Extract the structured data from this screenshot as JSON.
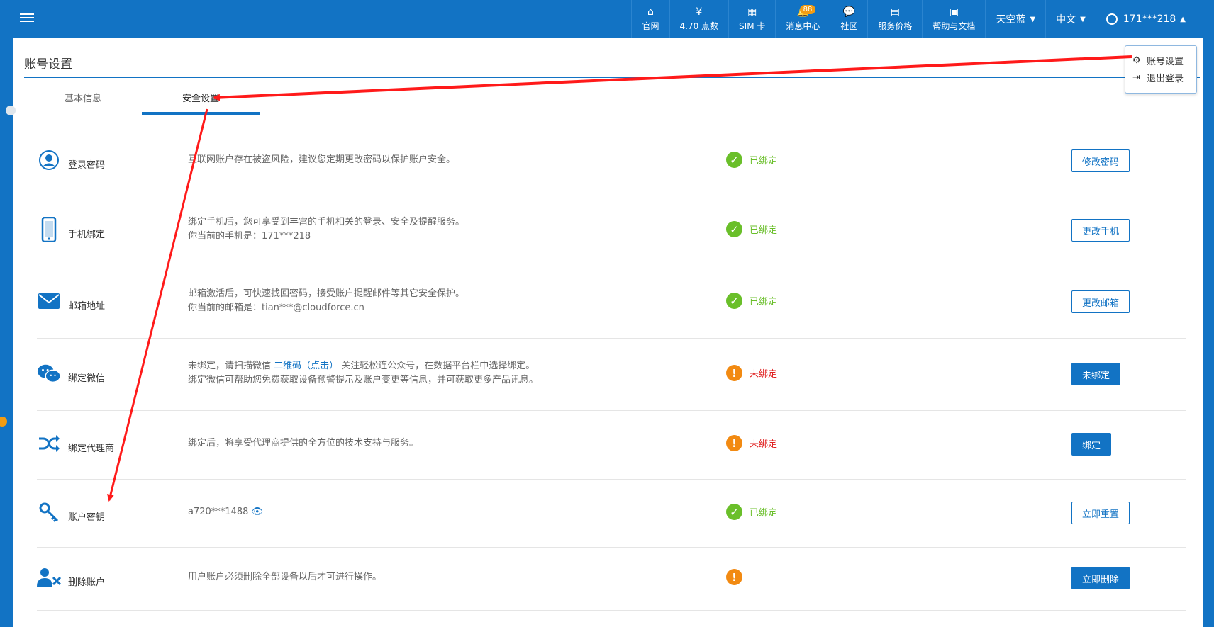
{
  "topbar": {
    "nav": [
      {
        "id": "home",
        "glyph": "⌂",
        "label": "官网"
      },
      {
        "id": "points",
        "glyph": "¥",
        "label": "4.70 点数"
      },
      {
        "id": "sim",
        "glyph": "▦",
        "label": "SIM 卡"
      },
      {
        "id": "messages",
        "glyph": "🔔",
        "label": "消息中心",
        "badge": "88"
      },
      {
        "id": "community",
        "glyph": "💬",
        "label": "社区"
      },
      {
        "id": "pricing",
        "glyph": "▤",
        "label": "服务价格"
      },
      {
        "id": "help",
        "glyph": "▣",
        "label": "帮助与文档"
      }
    ],
    "theme": "天空蓝",
    "language": "中文",
    "user": "171***218"
  },
  "dropdown": {
    "items": [
      {
        "glyph": "⚙",
        "label": "账号设置"
      },
      {
        "glyph": "⇥",
        "label": "退出登录"
      }
    ]
  },
  "page": {
    "title": "账号设置",
    "tabs": [
      "基本信息",
      "安全设置"
    ],
    "active_tab": 1
  },
  "rows": [
    {
      "key": "password",
      "icon": "user-circle-icon",
      "name": "登录密码",
      "desc": [
        "互联网账户存在被盗风险，建议您定期更改密码以保护账户安全。"
      ],
      "status": "已绑定",
      "status_kind": "ok",
      "action": "修改密码",
      "action_style": "outline"
    },
    {
      "key": "phone",
      "icon": "mobile-phone-icon",
      "name": "手机绑定",
      "desc": [
        "绑定手机后，您可享受到丰富的手机相关的登录、安全及提醒服务。",
        "你当前的手机是：171***218"
      ],
      "status": "已绑定",
      "status_kind": "ok",
      "action": "更改手机",
      "action_style": "outline"
    },
    {
      "key": "email",
      "icon": "envelope-icon",
      "name": "邮箱地址",
      "desc": [
        "邮箱激活后，可快速找回密码，接受账户提醒邮件等其它安全保护。",
        "你当前的邮箱是：tian***@cloudforce.cn"
      ],
      "status": "已绑定",
      "status_kind": "ok",
      "action": "更改邮箱",
      "action_style": "outline"
    },
    {
      "key": "wechat",
      "icon": "wechat-icon",
      "name": "绑定微信",
      "desc_parts": {
        "before": "未绑定，请扫描微信 ",
        "link": "二维码（点击）",
        "after": " 关注轻松连公众号，在数据平台栏中选择绑定。"
      },
      "desc": [
        "绑定微信可帮助您免费获取设备预警提示及账户变更等信息，并可获取更多产品讯息。"
      ],
      "status": "未绑定",
      "status_kind": "warn",
      "action": "未绑定",
      "action_style": "solid"
    },
    {
      "key": "agent",
      "icon": "shuffle-icon",
      "name": "绑定代理商",
      "desc": [
        "绑定后，将享受代理商提供的全方位的技术支持与服务。"
      ],
      "status": "未绑定",
      "status_kind": "warn",
      "action": "绑定",
      "action_style": "solid"
    },
    {
      "key": "apikey",
      "icon": "key-icon",
      "name": "账户密钥",
      "desc": [
        "a720***1488"
      ],
      "status": "已绑定",
      "status_kind": "ok",
      "action": "立即重置",
      "action_style": "outline",
      "eye": true
    },
    {
      "key": "delete",
      "icon": "user-delete-icon",
      "name": "删除账户",
      "desc": [
        "用户账户必须删除全部设备以后才可进行操作。"
      ],
      "status": "",
      "status_kind": "warn",
      "action": "立即删除",
      "action_style": "solid"
    }
  ],
  "colors": {
    "brand": "#1273c4",
    "ok": "#6abf2a",
    "warn_icon": "#f28a12",
    "warn_text": "#e02020",
    "annotation": "#ff1a1a"
  }
}
